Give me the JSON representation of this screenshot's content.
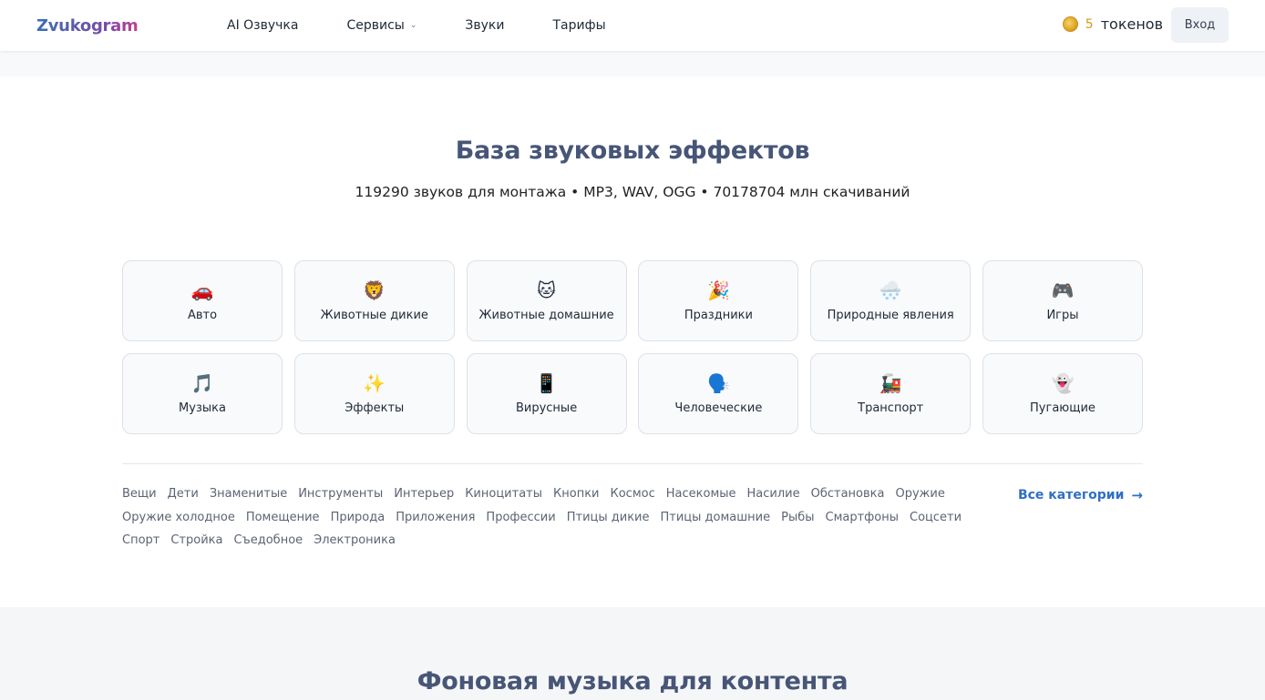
{
  "header": {
    "logo_text": "Zvukogram",
    "nav": [
      {
        "label": "AI Озвучка",
        "has_dropdown": false
      },
      {
        "label": "Сервисы",
        "has_dropdown": true
      },
      {
        "label": "Звуки",
        "has_dropdown": false
      },
      {
        "label": "Тарифы",
        "has_dropdown": false
      }
    ],
    "tokens_count": "5",
    "tokens_label": "токенов",
    "login_label": "Вход"
  },
  "main": {
    "title": "База звуковых эффектов",
    "subtitle": "119290 звуков для монтажа • MP3, WAV, OGG • 70178704 млн скачиваний",
    "categories": [
      {
        "emoji": "🚗",
        "label": "Авто"
      },
      {
        "emoji": "🦁",
        "label": "Животные дикие"
      },
      {
        "emoji": "🐱",
        "label": "Животные домашние"
      },
      {
        "emoji": "🎉",
        "label": "Праздники"
      },
      {
        "emoji": "🌨️",
        "label": "Природные явления"
      },
      {
        "emoji": "🎮",
        "label": "Игры"
      },
      {
        "emoji": "🎵",
        "label": "Музыка"
      },
      {
        "emoji": "✨",
        "label": "Эффекты"
      },
      {
        "emoji": "📱",
        "label": "Вирусные"
      },
      {
        "emoji": "🗣️",
        "label": "Человеческие"
      },
      {
        "emoji": "🚂",
        "label": "Транспорт"
      },
      {
        "emoji": "👻",
        "label": "Пугающие"
      }
    ],
    "tags": [
      "Вещи",
      "Дети",
      "Знаменитые",
      "Инструменты",
      "Интерьер",
      "Киноцитаты",
      "Кнопки",
      "Космос",
      "Насекомые",
      "Насилие",
      "Обстановка",
      "Оружие",
      "Оружие холодное",
      "Помещение",
      "Природа",
      "Приложения",
      "Профессии",
      "Птицы дикие",
      "Птицы домашние",
      "Рыбы",
      "Смартфоны",
      "Соцсети",
      "Спорт",
      "Стройка",
      "Съедобное",
      "Электроника"
    ],
    "all_categories_label": "Все категории",
    "all_categories_arrow": "→"
  },
  "bottom": {
    "title": "Фоновая музыка для контента"
  },
  "colors": {
    "title": "#475577",
    "link": "#2f6fc4",
    "token": "#d49a1a"
  }
}
